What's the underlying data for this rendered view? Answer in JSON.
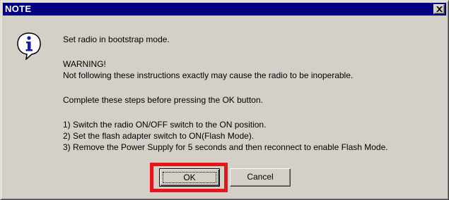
{
  "window": {
    "title": "NOTE",
    "close_glyph": "✕"
  },
  "icon": {
    "name": "info-icon"
  },
  "message": {
    "line1": "Set radio in bootstrap mode.",
    "line2": "WARNING!",
    "line3": "Not following these instructions exactly may cause the radio to be inoperable.",
    "line4": "Complete these steps before pressing the OK button.",
    "step1": "1) Switch the radio ON/OFF switch to the ON position.",
    "step2": "2) Set the flash adapter switch to ON(Flash Mode).",
    "step3": "3) Remove the Power Supply for 5 seconds and then reconnect to enable Flash Mode."
  },
  "buttons": {
    "ok_label": "OK",
    "cancel_label": "Cancel"
  },
  "colors": {
    "titlebar": "#000080",
    "dialog_bg": "#d4d0c8",
    "highlight": "#e8141c"
  }
}
